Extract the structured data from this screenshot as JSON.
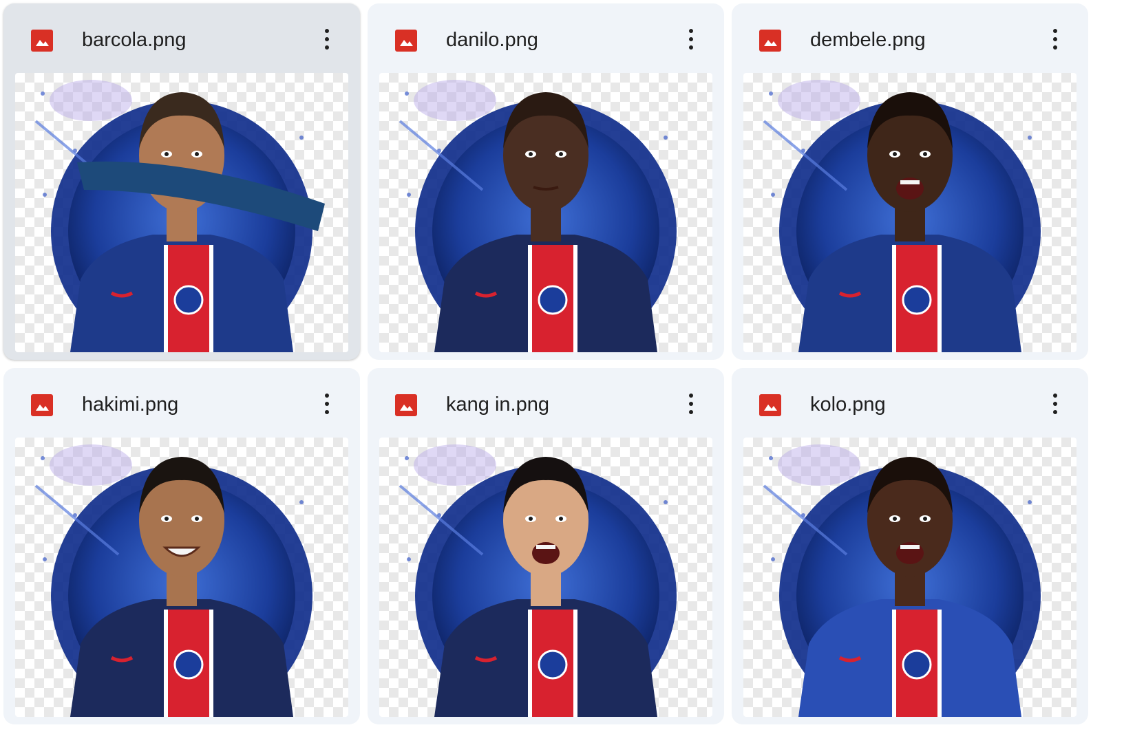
{
  "files": [
    {
      "name": "barcola.png",
      "selected": true,
      "skin": "#b07a55",
      "hair": "#3a2a1e",
      "kit": "#1e3a8a",
      "pose": "arm"
    },
    {
      "name": "danilo.png",
      "selected": false,
      "skin": "#4a2e22",
      "hair": "#2a1a12",
      "kit": "#1c2a5c",
      "pose": "stand"
    },
    {
      "name": "dembele.png",
      "selected": false,
      "skin": "#3f2619",
      "hair": "#1a0f0a",
      "kit": "#1e3a8a",
      "pose": "shout"
    },
    {
      "name": "hakimi.png",
      "selected": false,
      "skin": "#a8744f",
      "hair": "#1a1410",
      "kit": "#1c2a5c",
      "pose": "smile"
    },
    {
      "name": "kang in.png",
      "selected": false,
      "skin": "#d9a884",
      "hair": "#151010",
      "kit": "#1c2a5c",
      "pose": "shout"
    },
    {
      "name": "kolo.png",
      "selected": false,
      "skin": "#4a2a1c",
      "hair": "#1a0f0a",
      "kit": "#2a4fb5",
      "pose": "shout"
    }
  ],
  "icons": {
    "file_type": "image-file-icon",
    "more": "more-vert-icon"
  },
  "colors": {
    "card_bg": "#f0f4f9",
    "card_selected_bg": "#e1e5ea",
    "image_icon": "#d93025",
    "psg_red": "#d8222f",
    "psg_blue": "#1e3a8a"
  }
}
